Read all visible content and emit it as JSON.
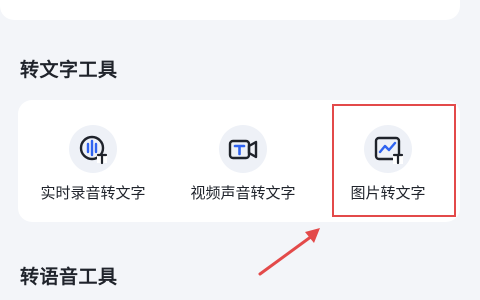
{
  "sections": {
    "speech_to_text": {
      "title": "转文字工具",
      "tools": [
        {
          "label": "实时录音转文字",
          "icon": "mic-text-icon"
        },
        {
          "label": "视频声音转文字",
          "icon": "video-text-icon"
        },
        {
          "label": "图片转文字",
          "icon": "image-text-icon"
        }
      ]
    },
    "text_to_speech": {
      "title": "转语音工具"
    }
  },
  "colors": {
    "accent": "#2f63f0",
    "icon_bg": "#eef1f7",
    "highlight": "#e34a4a",
    "page_bg": "#f3f5f9"
  }
}
